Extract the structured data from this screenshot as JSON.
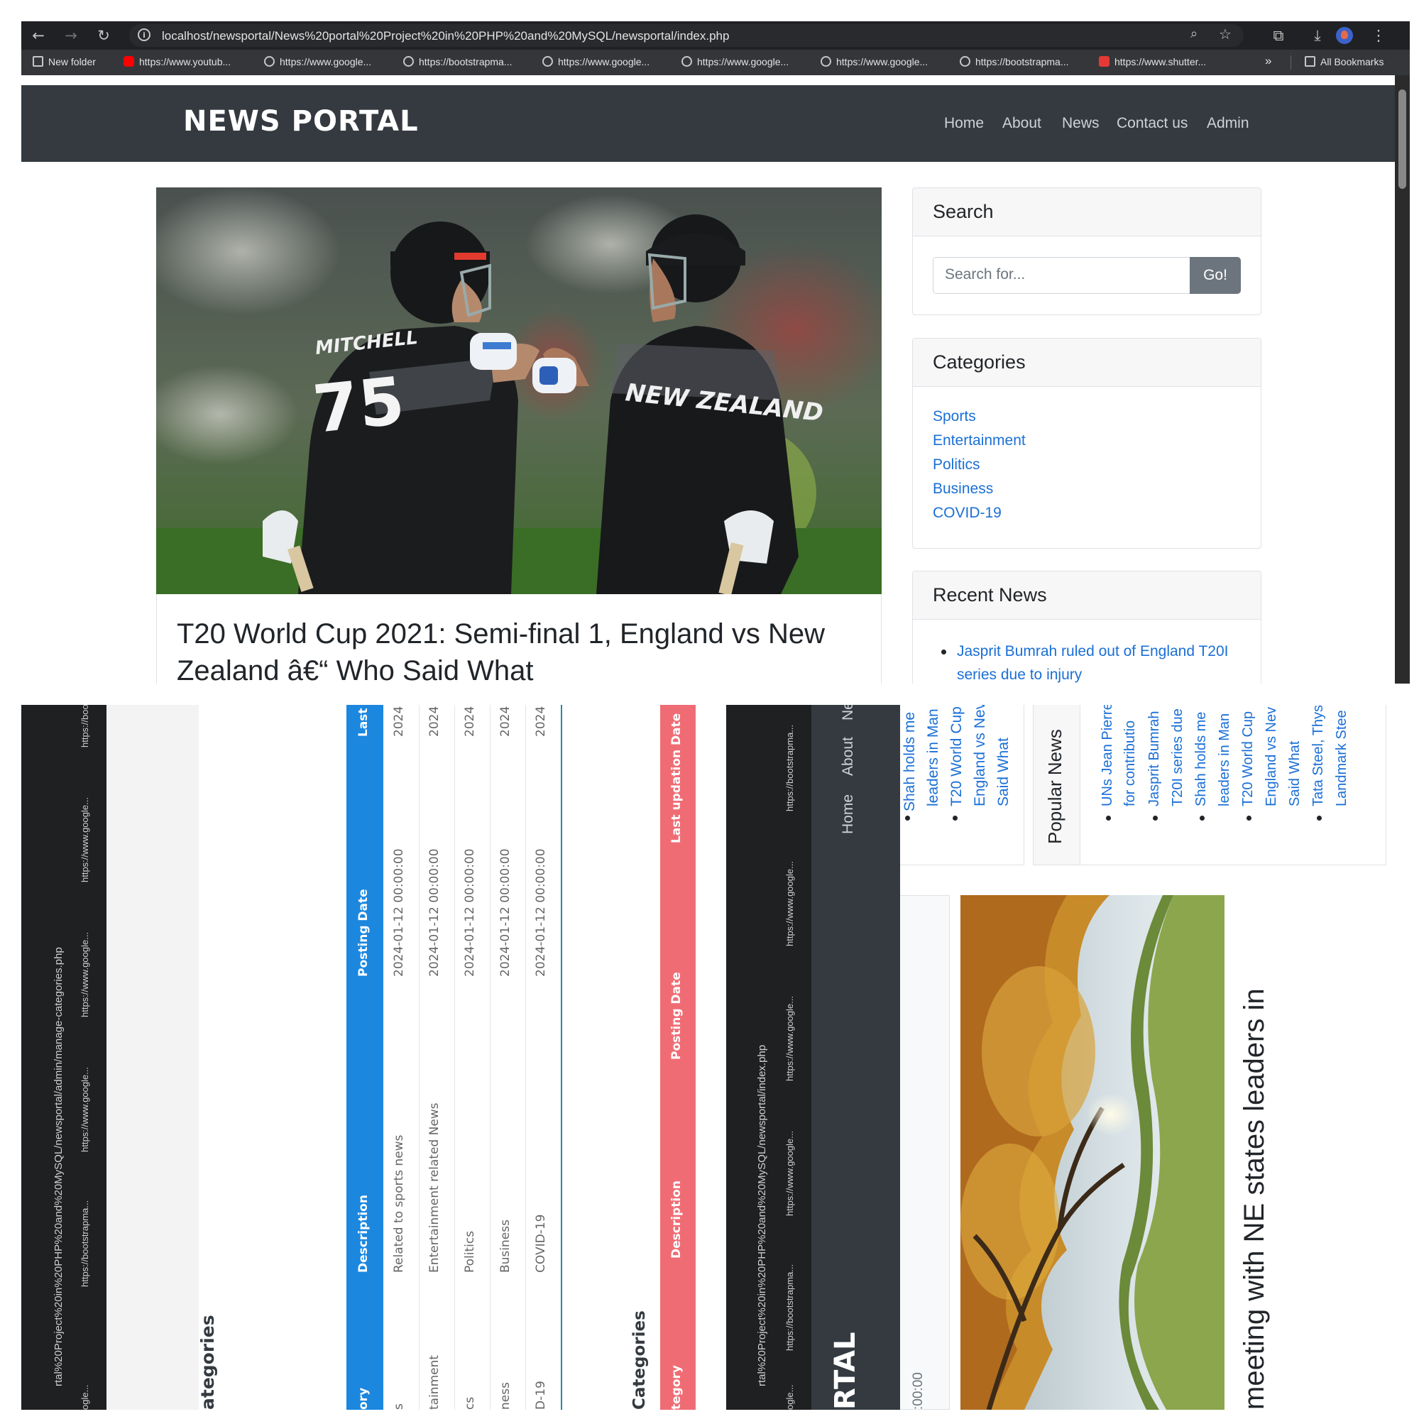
{
  "browser": {
    "url": "localhost/newsportal/News%20portal%20Project%20in%20PHP%20and%20MySQL/newsportal/index.php",
    "bookmarks": [
      {
        "label": "New folder",
        "icon": "folder-icon"
      },
      {
        "label": "https://www.youtub...",
        "icon": "youtube-icon"
      },
      {
        "label": "https://www.google...",
        "icon": "globe-icon"
      },
      {
        "label": "https://bootstrapma...",
        "icon": "globe-icon"
      },
      {
        "label": "https://www.google...",
        "icon": "globe-icon"
      },
      {
        "label": "https://www.google...",
        "icon": "globe-icon"
      },
      {
        "label": "https://www.google...",
        "icon": "globe-icon"
      },
      {
        "label": "https://bootstrapma...",
        "icon": "globe-icon"
      },
      {
        "label": "https://www.shutter...",
        "icon": "shutterstock-icon"
      }
    ],
    "more": "»",
    "all_bookmarks": "All Bookmarks"
  },
  "site": {
    "brand": "NEWS PORTAL",
    "nav": [
      "Home",
      "About",
      "News",
      "Contact us",
      "Admin"
    ]
  },
  "post": {
    "title": "T20 World Cup 2021: Semi-final 1, England vs New Zealand â€“ Who Said What",
    "jersey_name": "MITCHELL",
    "jersey_number": "75",
    "jersey_team": "NEW ZEALAND"
  },
  "sidebar": {
    "search": {
      "title": "Search",
      "placeholder": "Search for...",
      "button": "Go!"
    },
    "categories": {
      "title": "Categories",
      "items": [
        "Sports",
        "Entertainment",
        "Politics",
        "Business",
        "COVID-19"
      ]
    },
    "recent": {
      "title": "Recent News",
      "items": [
        "Jasprit Bumrah ruled out of England T20I series due to injury"
      ]
    }
  },
  "admin_panel": {
    "url_fragment": "rtal%20Project%20in%20PHP%20and%20MySQL/newsportal/admin/manage-categories.php",
    "bookmarks": [
      "https://bootstrapma...",
      "https://www.google...",
      "https://www.google...",
      "https://www.google...",
      "https://bootstrapma...",
      "ogle..."
    ],
    "page_heading": "ategories",
    "table_headers": [
      "ory",
      "Description",
      "Posting Date",
      "Last u"
    ],
    "rows": [
      {
        "category": "s",
        "description": "Related to sports news",
        "posting": "2024-01-12 00:00:00",
        "updated": "2024"
      },
      {
        "category": "tainment",
        "description": "Entertainment related News",
        "posting": "2024-01-12 00:00:00",
        "updated": "2024"
      },
      {
        "category": "cs",
        "description": "Politics",
        "posting": "2024-01-12 00:00:00",
        "updated": "2024"
      },
      {
        "category": "ness",
        "description": "Business",
        "posting": "2024-01-12 00:00:00",
        "updated": "2024"
      },
      {
        "category": "D-19",
        "description": "COVID-19",
        "posting": "2024-01-12 00:00:00",
        "updated": "2024"
      }
    ],
    "deleted_heading": "Categories",
    "deleted_headers": [
      "tegory",
      "Description",
      "Posting Date",
      "Last updation Date"
    ]
  },
  "news_panel": {
    "url_fragment": "rtal%20Project%20in%20PHP%20and%20MySQL/newsportal/index.php",
    "bookmarks": [
      "https://bootstrapma...",
      "https://www.google...",
      "https://www.google...",
      "https://www.google...",
      "https://bootstrapma...",
      "ogle..."
    ],
    "brand_fragment": "RTAL",
    "nav": [
      "Home",
      "About",
      "Ne"
    ],
    "recent_fragments": [
      "Shah holds me",
      "leaders in Man",
      "T20 World Cup",
      "England vs Nev",
      "Said What"
    ],
    "popular_title": "Popular News",
    "popular_items": [
      "UNs Jean Pierre",
      "for contributio",
      "Jasprit Bumrah",
      "T20I series due",
      "Shah holds me",
      "leaders in Man",
      "T20 World Cup",
      "England vs Nev",
      "Said What",
      "Tata Steel, Thys",
      "Landmark Stee"
    ],
    "time_fragment": ":00:00",
    "article_title": "meeting with NE states leaders in"
  }
}
